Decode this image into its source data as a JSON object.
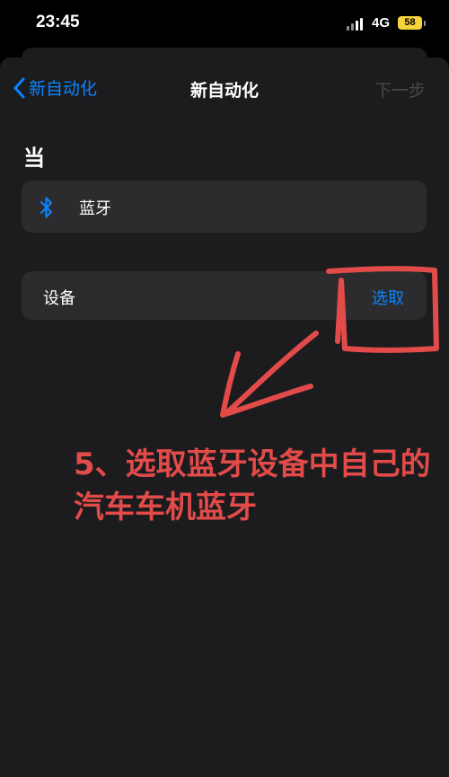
{
  "status_bar": {
    "time": "23:45",
    "network": "4G",
    "battery": "58"
  },
  "nav": {
    "back_label": "新自动化",
    "title": "新自动化",
    "next_label": "下一步"
  },
  "section": {
    "title": "当"
  },
  "trigger": {
    "label": "蓝牙",
    "icon": "bluetooth-icon"
  },
  "device": {
    "label": "设备",
    "action": "选取"
  },
  "annotation": {
    "text": "5、选取蓝牙设备中自己的汽车车机蓝牙"
  },
  "colors": {
    "accent": "#0a84ff",
    "annotation": "#e24b49",
    "battery": "#f5d33b",
    "sheet": "#1c1c1e",
    "row": "#2c2c2e"
  }
}
